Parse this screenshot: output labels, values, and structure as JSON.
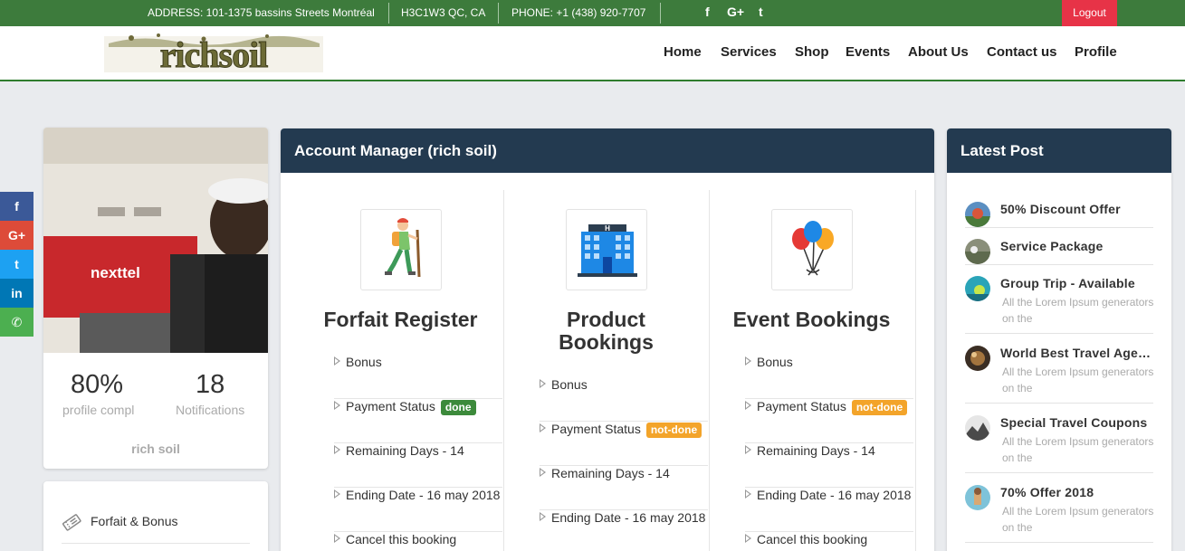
{
  "topbar": {
    "address": "ADDRESS: 101-1375 bassins Streets Montréal",
    "postal": "H3C1W3 QC, CA",
    "phone": "PHONE: +1 (438) 920-7707",
    "social": [
      "f",
      "G+",
      "t"
    ],
    "logout": "Logout"
  },
  "header": {
    "logo_text": "richsoil",
    "nav": [
      "Home",
      "Services",
      "Shop",
      "Events",
      "About Us",
      "Contact us",
      "Profile"
    ]
  },
  "side_social": [
    {
      "icon": "facebook-icon",
      "glyph": "f",
      "color": "#3b5998"
    },
    {
      "icon": "google-plus-icon",
      "glyph": "G+",
      "color": "#dd4b39"
    },
    {
      "icon": "twitter-icon",
      "glyph": "t",
      "color": "#1da1f2"
    },
    {
      "icon": "linkedin-icon",
      "glyph": "in",
      "color": "#0077b5"
    },
    {
      "icon": "whatsapp-icon",
      "glyph": "✆",
      "color": "#4caf50"
    }
  ],
  "profile": {
    "completion_value": "80%",
    "completion_label": "profile compl",
    "notifications_value": "18",
    "notifications_label": "Notifications",
    "name": "rich soil",
    "photo_sign_text": "nexttel"
  },
  "sidebar_menu": {
    "items": [
      {
        "label": "Forfait & Bonus",
        "icon": "ticket-icon"
      }
    ]
  },
  "account_manager": {
    "title": "Account Manager (rich soil)",
    "columns": [
      {
        "icon": "hiker-icon",
        "title": "Forfait Register",
        "rows": [
          {
            "text": "Bonus"
          },
          {
            "text": "Payment Status",
            "badge": "done",
            "badge_type": "done"
          },
          {
            "text": "Remaining Days - 14"
          },
          {
            "text": "Ending Date - 16 may 2018"
          },
          {
            "text": "Cancel this booking"
          }
        ]
      },
      {
        "icon": "hotel-icon",
        "title": "Product Bookings",
        "hotel_sign": "H",
        "rows": [
          {
            "text": "Bonus"
          },
          {
            "text": "Payment Status",
            "badge": "not-done",
            "badge_type": "notdone"
          },
          {
            "text": "Remaining Days - 14"
          },
          {
            "text": "Ending Date - 16 may 2018"
          }
        ]
      },
      {
        "icon": "balloons-icon",
        "title": "Event Bookings",
        "rows": [
          {
            "text": "Bonus"
          },
          {
            "text": "Payment Status",
            "badge": "not-done",
            "badge_type": "notdone"
          },
          {
            "text": "Remaining Days - 14"
          },
          {
            "text": "Ending Date - 16 may 2018"
          },
          {
            "text": "Cancel this booking"
          }
        ]
      }
    ]
  },
  "latest_post": {
    "title": "Latest Post",
    "posts": [
      {
        "title": "50% Discount Offer",
        "desc": ""
      },
      {
        "title": "Service Package",
        "desc": ""
      },
      {
        "title": "Group Trip - Available",
        "desc": "All the Lorem Ipsum generators on the"
      },
      {
        "title": "World Best Travel Agency",
        "desc": "All the Lorem Ipsum generators on the"
      },
      {
        "title": "Special Travel Coupons",
        "desc": "All the Lorem Ipsum generators on the"
      },
      {
        "title": "70% Offer 2018",
        "desc": "All the Lorem Ipsum generators on the"
      }
    ]
  },
  "colors": {
    "topbar_green": "#3d7b3c",
    "logout_red": "#e73347",
    "panel_header": "#233a50",
    "badge_done": "#3c8a3b",
    "badge_notdone": "#f3a42a"
  }
}
